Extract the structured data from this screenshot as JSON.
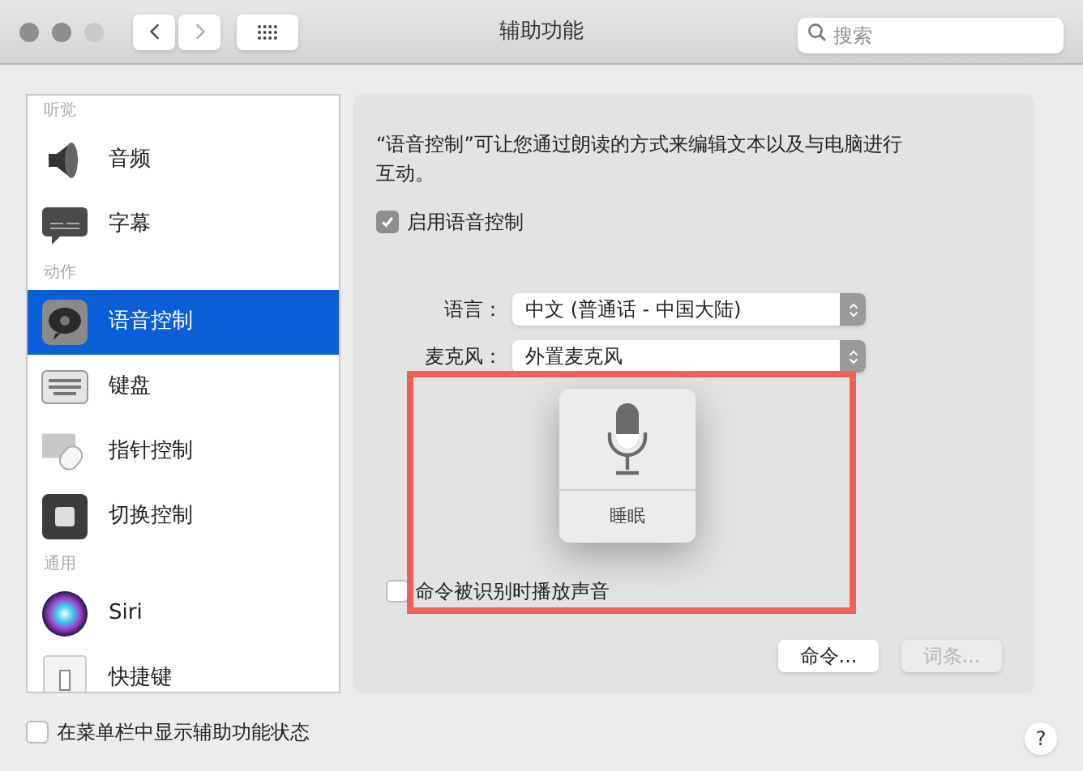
{
  "window": {
    "title": "辅助功能"
  },
  "search": {
    "placeholder": "搜索"
  },
  "sidebar": {
    "items": [
      {
        "kind": "header",
        "label": "听觉"
      },
      {
        "kind": "item",
        "label": "音频",
        "selected": false
      },
      {
        "kind": "item",
        "label": "字幕",
        "selected": false
      },
      {
        "kind": "header",
        "label": "动作"
      },
      {
        "kind": "item",
        "label": "语音控制",
        "selected": true
      },
      {
        "kind": "item",
        "label": "键盘",
        "selected": false
      },
      {
        "kind": "item",
        "label": "指针控制",
        "selected": false
      },
      {
        "kind": "item",
        "label": "切换控制",
        "selected": false
      },
      {
        "kind": "header",
        "label": "通用"
      },
      {
        "kind": "item",
        "label": "Siri",
        "selected": false
      },
      {
        "kind": "item",
        "label": "快捷键",
        "selected": false
      }
    ]
  },
  "panel": {
    "description": "“语音控制”可让您通过朗读的方式来编辑文本以及与电脑进行互动。",
    "enable": {
      "label": "启用语音控制",
      "checked": true
    },
    "fields": [
      {
        "label": "语言：",
        "value": "中文 (普通话 - 中国大陆)"
      },
      {
        "label": "麦克风：",
        "value": "外置麦克风"
      }
    ],
    "play_sound": {
      "label": "命令被识别时播放声音",
      "checked": false
    },
    "buttons": [
      {
        "label": "命令...",
        "disabled": false
      },
      {
        "label": "词条...",
        "disabled": true
      }
    ],
    "overlay": {
      "label": "睡眠"
    }
  },
  "menu_bar_status": {
    "label": "在菜单栏中显示辅助功能状态",
    "checked": false
  },
  "help": {
    "label": "?"
  }
}
